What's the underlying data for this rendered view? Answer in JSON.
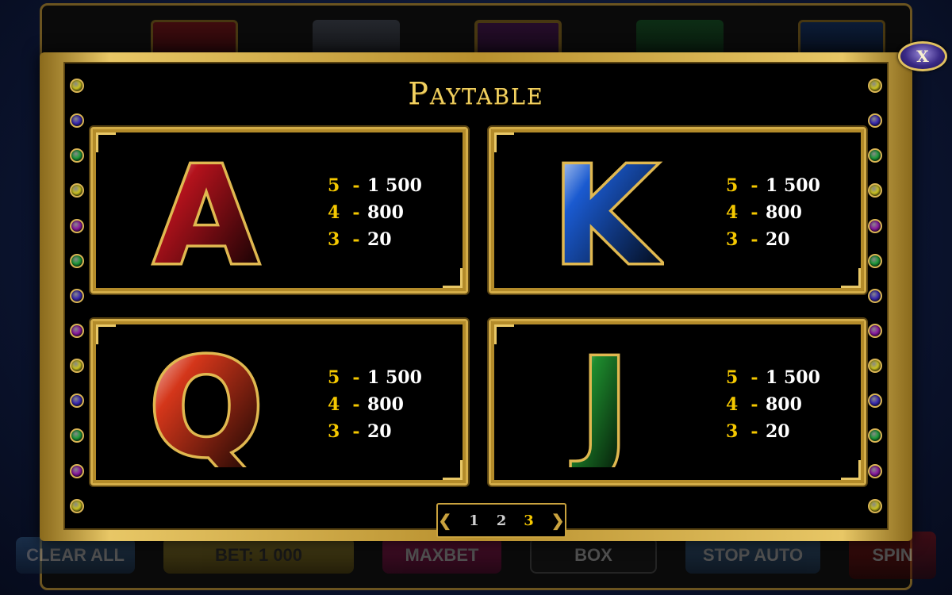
{
  "background": {
    "buttons": {
      "clear_all": "CLEAR ALL",
      "bet": "BET: 1 000",
      "maxbet": "MAXBET",
      "box": "BOX",
      "stop_auto": "STOP AUTO",
      "spin": "SPIN"
    }
  },
  "modal": {
    "title": "Paytable",
    "close_label": "X"
  },
  "symbols": [
    {
      "letter": "A",
      "icon": "ruby-letter-a",
      "gem_color": "#b3121c",
      "pays": [
        {
          "count": "5",
          "amount": "1 500"
        },
        {
          "count": "4",
          "amount": "800"
        },
        {
          "count": "3",
          "amount": "20"
        }
      ]
    },
    {
      "letter": "K",
      "icon": "sapphire-letter-k",
      "gem_color": "#1a5ad0",
      "pays": [
        {
          "count": "5",
          "amount": "1 500"
        },
        {
          "count": "4",
          "amount": "800"
        },
        {
          "count": "3",
          "amount": "20"
        }
      ]
    },
    {
      "letter": "Q",
      "icon": "garnet-letter-q",
      "gem_color": "#d4361a",
      "pays": [
        {
          "count": "5",
          "amount": "1 500"
        },
        {
          "count": "4",
          "amount": "800"
        },
        {
          "count": "3",
          "amount": "20"
        }
      ]
    },
    {
      "letter": "J",
      "icon": "emerald-letter-j",
      "gem_color": "#1e8c2e",
      "pays": [
        {
          "count": "5",
          "amount": "1 500"
        },
        {
          "count": "4",
          "amount": "800"
        },
        {
          "count": "3",
          "amount": "20"
        }
      ]
    }
  ],
  "pager": {
    "pages": [
      "1",
      "2",
      "3"
    ],
    "active_page": "3"
  },
  "colors": {
    "gold": "#d4ad48",
    "pay_count": "#f5c800",
    "pay_amount": "#ffffff"
  }
}
